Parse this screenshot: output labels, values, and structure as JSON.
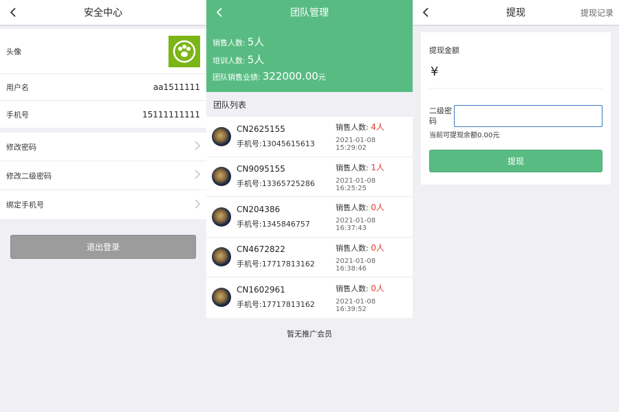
{
  "security": {
    "title": "安全中心",
    "avatar_label": "头像",
    "username_label": "用户名",
    "username_value": "aa1511111",
    "phone_label": "手机号",
    "phone_value": "15111111111",
    "links": [
      "修改密码",
      "修改二级密码",
      "绑定手机号"
    ],
    "logout_label": "退出登录"
  },
  "team": {
    "title": "团队管理",
    "stats": {
      "sales_label": "销售人数:",
      "sales_value": "5人",
      "training_label": "培训人数:",
      "training_value": "5人",
      "performance_label": "团队销售业绩:",
      "performance_value": "322000.00",
      "performance_unit": "元"
    },
    "list_title": "团队列表",
    "members": [
      {
        "id": "CN2625155",
        "phone_label": "手机号:",
        "phone": "13045615613",
        "sales_label": "销售人数:",
        "sales": "4人",
        "time": "2021-01-08 15:29:02"
      },
      {
        "id": "CN9095155",
        "phone_label": "手机号:",
        "phone": "13365725286",
        "sales_label": "销售人数:",
        "sales": "1人",
        "time": "2021-01-08 16:25:25"
      },
      {
        "id": "CN204386",
        "phone_label": "手机号:",
        "phone": "1345846757",
        "sales_label": "销售人数:",
        "sales": "0人",
        "time": "2021-01-08 16:37:43"
      },
      {
        "id": "CN4672822",
        "phone_label": "手机号:",
        "phone": "17717813162",
        "sales_label": "销售人数:",
        "sales": "0人",
        "time": "2021-01-08 16:38:46"
      },
      {
        "id": "CN1602961",
        "phone_label": "手机号:",
        "phone": "17717813162",
        "sales_label": "销售人数:",
        "sales": "0人",
        "time": "2021-01-08 16:39:52"
      }
    ],
    "no_more": "暂无推广会员"
  },
  "withdraw": {
    "title": "提现",
    "records_link": "提现记录",
    "amount_label": "提现金额",
    "currency_symbol": "¥",
    "password_label": "二级密码",
    "password_value": "",
    "balance_text": "当前可提现余额0.00元",
    "submit_label": "提现"
  },
  "colors": {
    "accent_green": "#58bc82",
    "sales_red": "#e23c2e",
    "logout_gray": "#9c9c9c",
    "avatar_green": "#7cb518"
  },
  "icons": {
    "back": "chevron-left-icon",
    "row_arrow": "chevron-right-icon",
    "avatar": "paw-logo"
  }
}
